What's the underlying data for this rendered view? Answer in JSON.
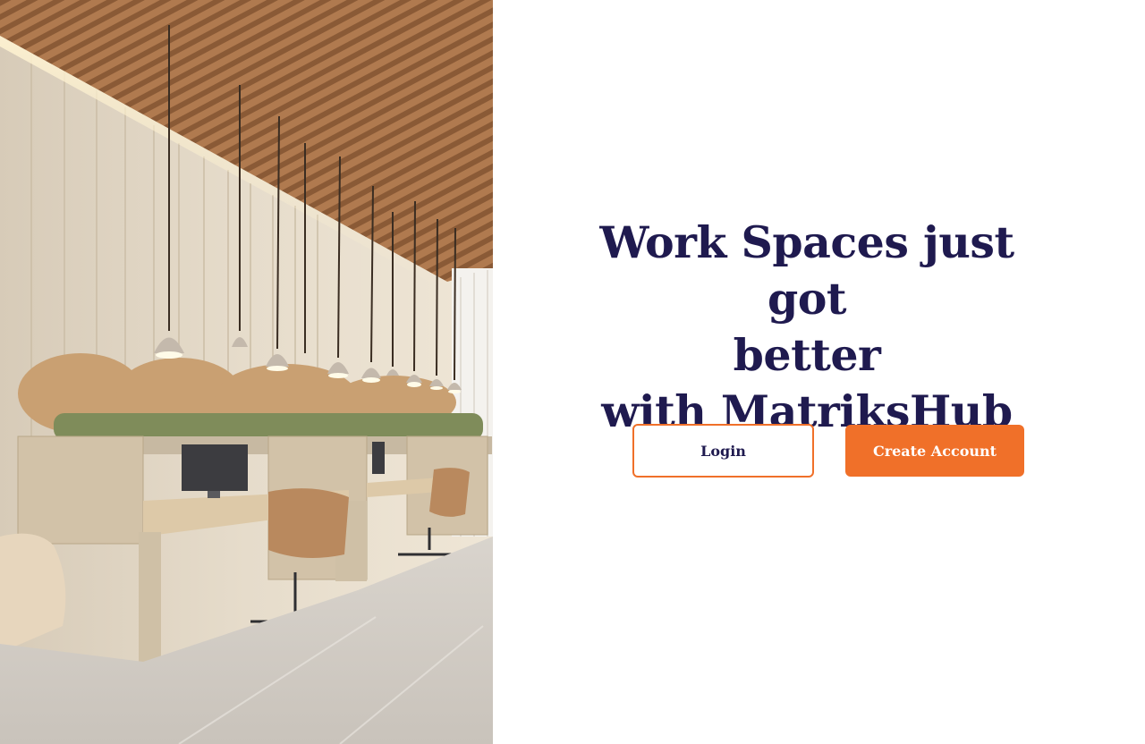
{
  "hero": {
    "headline_line1": "Work Spaces just got",
    "headline_line2": "better",
    "headline_line3": "with MatriksHub"
  },
  "actions": {
    "login_label": "Login",
    "create_account_label": "Create Account"
  },
  "colors": {
    "brand_navy": "#1f1a4f",
    "accent_orange": "#f07029",
    "background": "#ffffff"
  },
  "image": {
    "subject": "office-workspace-illustration"
  }
}
